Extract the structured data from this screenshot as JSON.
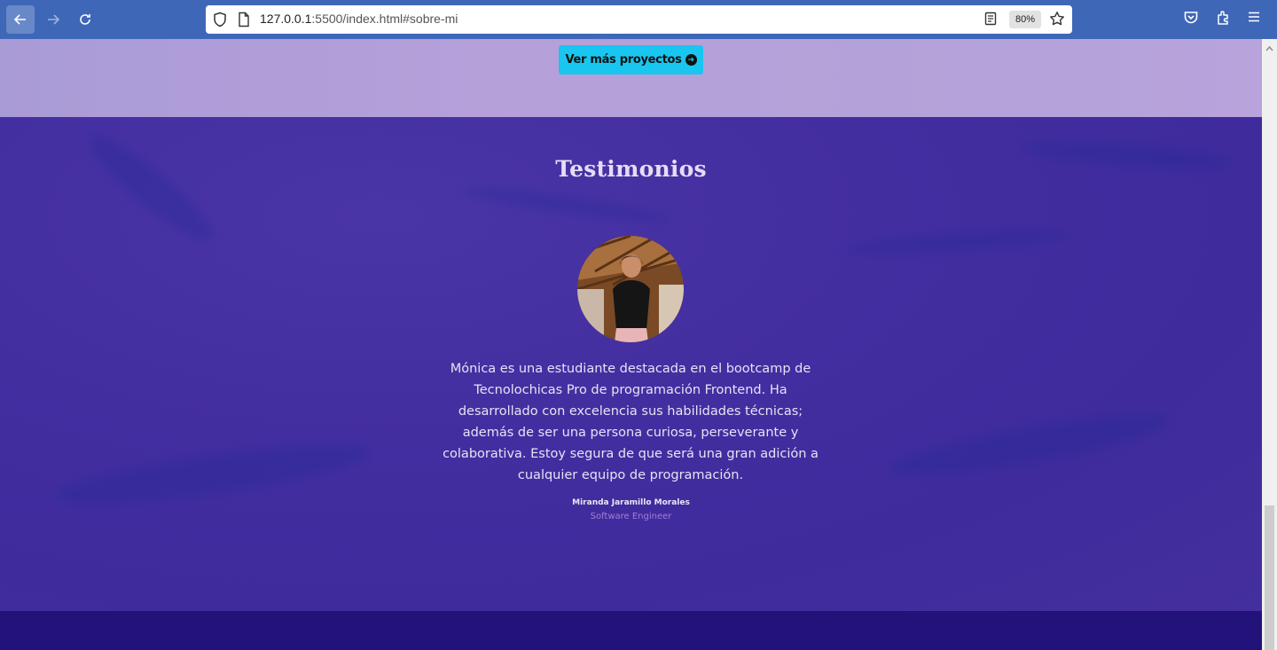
{
  "browser": {
    "url_host": "127.0.0.1",
    "url_rest": ":5500/index.html#sobre-mi",
    "zoom": "80%",
    "icons": [
      "back-arrow-icon",
      "forward-arrow-icon",
      "reload-icon",
      "shield-icon",
      "page-icon",
      "reader-view-icon",
      "star-icon",
      "pocket-icon",
      "extensions-icon",
      "hamburger-menu-icon"
    ]
  },
  "projects": {
    "cta_label": "Ver más proyectos"
  },
  "testimonials": {
    "title": "Testimonios",
    "quote": "Mónica es una estudiante destacada en el bootcamp de Tecnolochicas Pro de programación Frontend. Ha desarrollado con excelencia sus habilidades técnicas; además de ser una persona curiosa, perseverante y colaborativa. Estoy segura de que será una gran adición a cualquier equipo de programación.",
    "author": "Miranda Jaramillo Morales",
    "role": "Software Engineer"
  },
  "colors": {
    "toolbar": "#3f67b8",
    "cta": "#19c6ef",
    "projects_band": "#b3a2d9",
    "testimonials_bg": "#432ea0",
    "footer": "#22127a"
  }
}
